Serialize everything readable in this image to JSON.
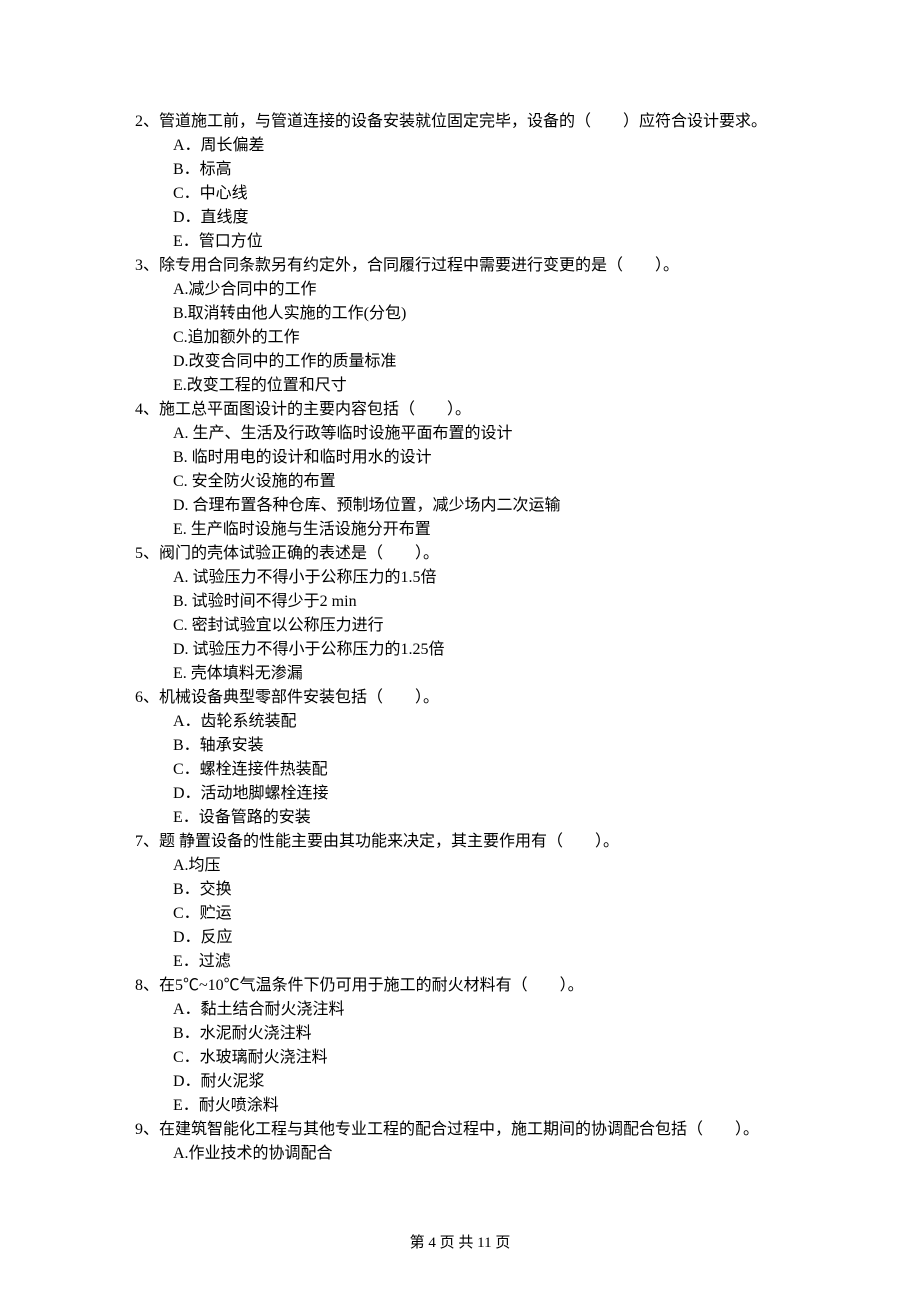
{
  "questions": [
    {
      "num": "2、",
      "stem": "管道施工前，与管道连接的设备安装就位固定完毕，设备的（　　）应符合设计要求。",
      "options": [
        "A．周长偏差",
        "B．标高",
        "C．中心线",
        "D．直线度",
        "E．管口方位"
      ]
    },
    {
      "num": "3、",
      "stem": "除专用合同条款另有约定外，合同履行过程中需要进行变更的是（　　）。",
      "options": [
        "A.减少合同中的工作",
        "B.取消转由他人实施的工作(分包)",
        "C.追加额外的工作",
        "D.改变合同中的工作的质量标准",
        "E.改变工程的位置和尺寸"
      ]
    },
    {
      "num": "4、",
      "stem": "施工总平面图设计的主要内容包括（　　）。",
      "options": [
        "A. 生产、生活及行政等临时设施平面布置的设计",
        "B. 临时用电的设计和临时用水的设计",
        "C. 安全防火设施的布置",
        "D. 合理布置各种仓库、预制场位置，减少场内二次运输",
        "E. 生产临时设施与生活设施分开布置"
      ]
    },
    {
      "num": "5、",
      "stem": "阀门的壳体试验正确的表述是（　　）。",
      "options": [
        "A. 试验压力不得小于公称压力的1.5倍",
        "B. 试验时间不得少于2 min",
        "C. 密封试验宜以公称压力进行",
        "D. 试验压力不得小于公称压力的1.25倍",
        "E. 壳体填料无渗漏"
      ]
    },
    {
      "num": "6、",
      "stem": "机械设备典型零部件安装包括（　　）。",
      "options": [
        "A．齿轮系统装配",
        "B．轴承安装",
        "C．螺栓连接件热装配",
        "D．活动地脚螺栓连接",
        "E．设备管路的安装"
      ]
    },
    {
      "num": "7、",
      "stem": "题 静置设备的性能主要由其功能来决定，其主要作用有（　　）。",
      "options": [
        "A.均压",
        "B．交换",
        "C．贮运",
        "D．反应",
        "E．过滤"
      ]
    },
    {
      "num": "8、",
      "stem": "在5℃~10℃气温条件下仍可用于施工的耐火材料有（　　）。",
      "options": [
        "A．黏土结合耐火浇注料",
        "B．水泥耐火浇注料",
        "C．水玻璃耐火浇注料",
        "D．耐火泥浆",
        "E．耐火喷涂料"
      ]
    },
    {
      "num": "9、",
      "stem": "在建筑智能化工程与其他专业工程的配合过程中，施工期间的协调配合包括（　　）。",
      "options": [
        "A.作业技术的协调配合"
      ]
    }
  ],
  "footer": "第 4 页 共 11 页"
}
